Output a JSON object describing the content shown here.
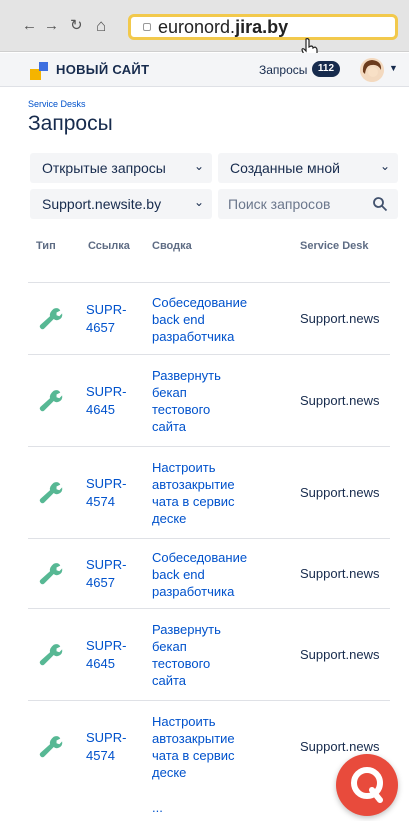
{
  "browser": {
    "url_prefix": "euronord.",
    "url_bold": "jira.by",
    "back_icon": "←",
    "forward_icon": "→",
    "reload_icon": "↻",
    "home_icon": "⌂"
  },
  "header": {
    "brand": "НОВЫЙ САЙТ",
    "requests_label": "Запросы",
    "requests_count": "112"
  },
  "page": {
    "breadcrumb": "Service Desks",
    "title": "Запросы"
  },
  "filters": {
    "status": "Открытые запросы",
    "creator": "Созданные мной",
    "project": "Support.newsite.by",
    "search_placeholder": "Поиск запросов"
  },
  "table": {
    "columns": [
      "Тип",
      "Ссылка",
      "Сводка",
      "Service Desk"
    ],
    "rows": [
      {
        "key": [
          "SUPR-",
          "4657"
        ],
        "summary": [
          "Собеседование",
          "back end",
          "разработчика"
        ],
        "desk": "Support.news"
      },
      {
        "key": [
          "SUPR-",
          "4645"
        ],
        "summary": [
          "Развернуть",
          "бекап",
          "тестового",
          "сайта"
        ],
        "desk": "Support.news"
      },
      {
        "key": [
          "SUPR-",
          "4574"
        ],
        "summary": [
          "Настроить",
          "автозакрытие",
          "чата в сервис",
          "деске"
        ],
        "desk": "Support.news"
      },
      {
        "key": [
          "SUPR-",
          "4657"
        ],
        "summary": [
          "Собеседование",
          "back end",
          "разработчика"
        ],
        "desk": "Support.news"
      },
      {
        "key": [
          "SUPR-",
          "4645"
        ],
        "summary": [
          "Развернуть",
          "бекап",
          "тестового",
          "сайта"
        ],
        "desk": "Support.news"
      },
      {
        "key": [
          "SUPR-",
          "4574"
        ],
        "summary": [
          "Настроить",
          "автозакрытие",
          "чата в сервис",
          "деске"
        ],
        "desk": "Support.news"
      }
    ],
    "more": "..."
  },
  "colors": {
    "link": "#0052cc",
    "text": "#172b4d",
    "wrench": "#57b894",
    "fab": "#e84b3c",
    "url_highlight": "#f2c94c"
  }
}
